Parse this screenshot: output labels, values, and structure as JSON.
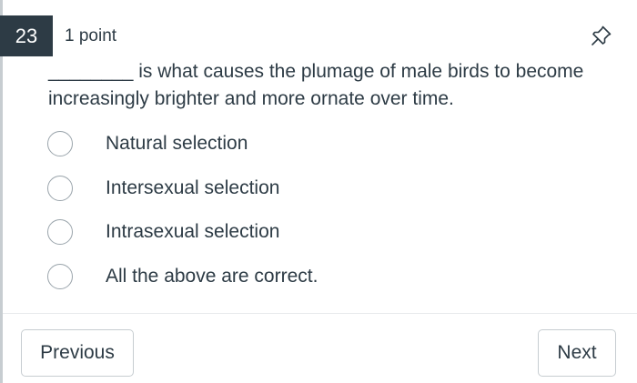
{
  "question": {
    "number": "23",
    "points": "1 point",
    "text": "________ is what causes the plumage of male birds to become increasingly brighter and more ornate over time."
  },
  "options": [
    {
      "label": "Natural selection"
    },
    {
      "label": "Intersexual selection"
    },
    {
      "label": "Intrasexual selection"
    },
    {
      "label": "All the above are correct."
    }
  ],
  "navigation": {
    "previous_label": "Previous",
    "next_label": "Next"
  },
  "icons": {
    "pin": "pin-icon"
  },
  "colors": {
    "text": "#2d3b45",
    "number_badge_bg": "#2d3b45",
    "border": "#c7cdd1"
  }
}
